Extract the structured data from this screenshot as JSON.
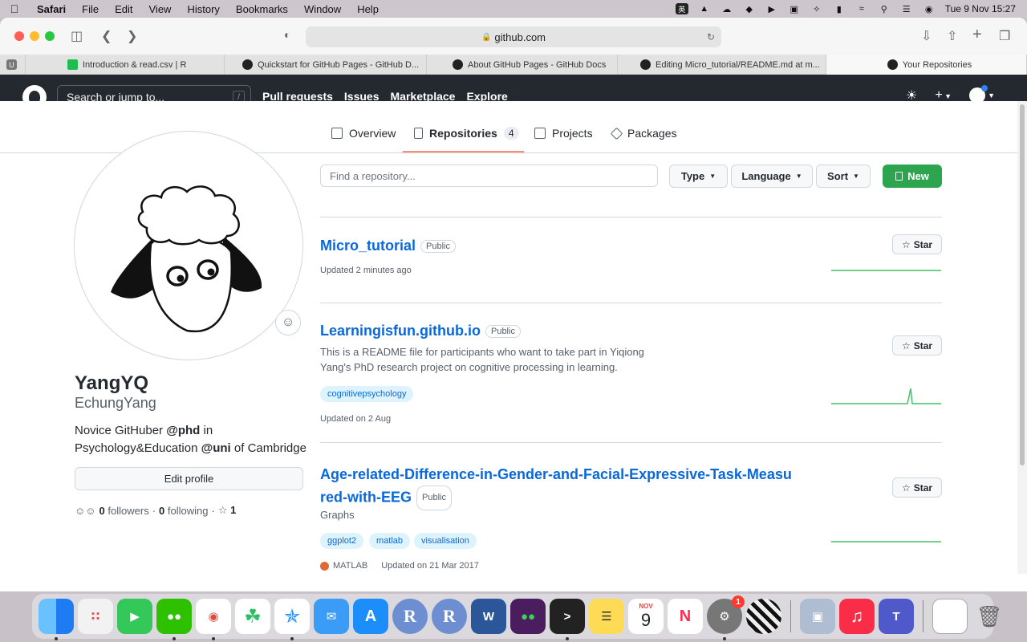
{
  "menubar": {
    "app": "Safari",
    "items": [
      "File",
      "Edit",
      "View",
      "History",
      "Bookmarks",
      "Window",
      "Help"
    ],
    "input_method": "英",
    "clock": "Tue 9 Nov  15:27"
  },
  "browser": {
    "url": "github.com",
    "tabs": [
      {
        "label": "U"
      },
      {
        "label": "Introduction & read.csv | R"
      },
      {
        "label": "Quickstart for GitHub Pages - GitHub D..."
      },
      {
        "label": "About GitHub Pages - GitHub Docs"
      },
      {
        "label": "Editing Micro_tutorial/README.md at m..."
      },
      {
        "label": "Your Repositories"
      }
    ]
  },
  "github_header": {
    "search_placeholder": "Search or jump to...",
    "search_key": "/",
    "nav": [
      "Pull requests",
      "Issues",
      "Marketplace",
      "Explore"
    ],
    "plus": "+"
  },
  "profile_tabs": {
    "overview": "Overview",
    "repositories": "Repositories",
    "repositories_count": "4",
    "projects": "Projects",
    "packages": "Packages"
  },
  "profile": {
    "name": "YangYQ",
    "login": "EchungYang",
    "bio_1": "Novice GitHuber ",
    "bio_phd": "@phd",
    "bio_2": " in Psychology&Education ",
    "bio_uni": "@uni",
    "bio_3": " of Cambridge",
    "edit_label": "Edit profile",
    "followers_count": "0",
    "followers_label": "followers",
    "sep": "·",
    "following_count": "0",
    "following_label": "following",
    "stars_count": "1"
  },
  "repo_filters": {
    "find_placeholder": "Find a repository...",
    "type": "Type",
    "language": "Language",
    "sort": "Sort",
    "new": "New"
  },
  "repos": [
    {
      "name": "Micro_tutorial",
      "visibility": "Public",
      "updated": "Updated 2 minutes ago",
      "star": "Star"
    },
    {
      "name": "Learningisfun.github.io",
      "visibility": "Public",
      "description": "This is a README file for participants who want to take part in Yiqiong Yang's PhD research project on cognitive processing in learning.",
      "topics": [
        "cognitivepsychology"
      ],
      "updated": "Updated on 2 Aug",
      "star": "Star"
    },
    {
      "name_1": "Age-related-Difference-in-Gender-and-Facial-Expressive-Task-Measu",
      "name_2": "red-with-EEG",
      "visibility": "Public",
      "description": "Graphs",
      "topics": [
        "ggplot2",
        "matlab",
        "visualisation"
      ],
      "language": "MATLAB",
      "language_color": "#e16737",
      "updated": "Updated on 21 Mar 2017",
      "star": "Star"
    }
  ],
  "dock": {
    "calendar_month": "NOV",
    "calendar_day": "9",
    "settings_badge": "1"
  }
}
